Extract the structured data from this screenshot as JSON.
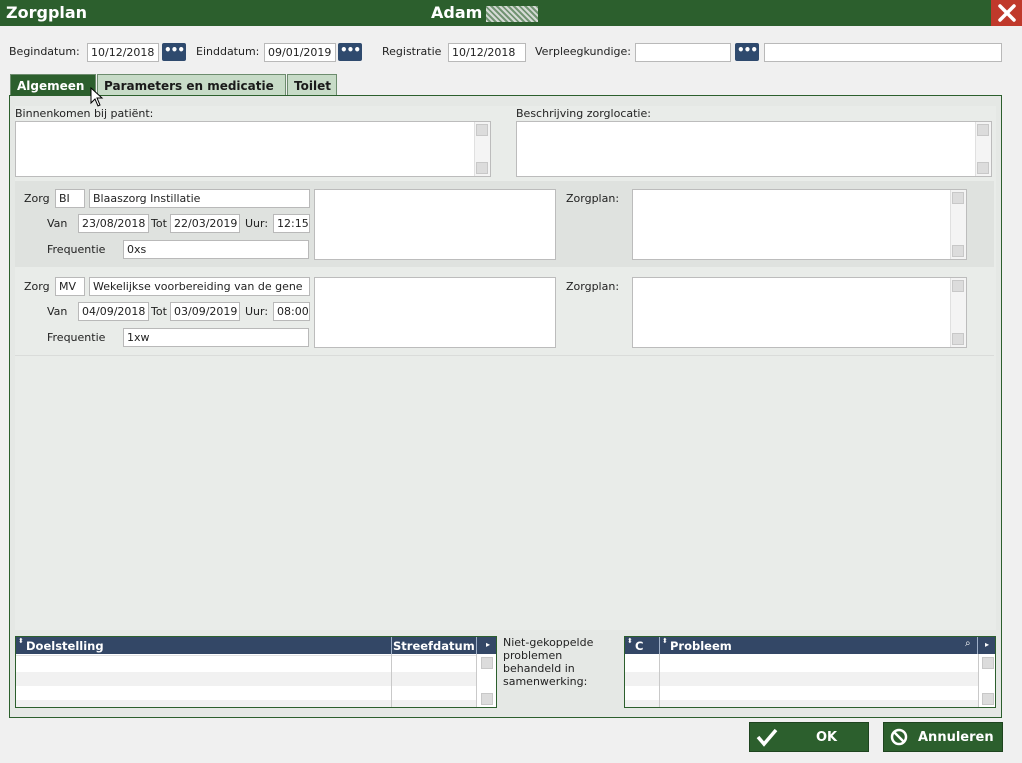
{
  "window": {
    "title": "Zorgplan",
    "patient_name": "Adam"
  },
  "header": {
    "begindatum_label": "Begindatum:",
    "begindatum_value": "10/12/2018",
    "einddatum_label": "Einddatum:",
    "einddatum_value": "09/01/2019",
    "registratie_label": "Registratie",
    "registratie_value": "10/12/2018",
    "verpleegkundige_label": "Verpleegkundige:",
    "verpleegkundige_code": "",
    "verpleegkundige_name": "",
    "picker_glyph": "•••"
  },
  "tabs": [
    {
      "label": "Algemeen",
      "active": true
    },
    {
      "label": "Parameters en medicatie",
      "active": false
    },
    {
      "label": "Toilet",
      "active": false
    }
  ],
  "general": {
    "binnenkomen_label": "Binnenkomen bij patiënt:",
    "beschrijving_label": "Beschrijving zorglocatie:"
  },
  "care_items": [
    {
      "zorg_label": "Zorg",
      "code": "BI",
      "description": "Blaaszorg Instillatie",
      "van_label": "Van",
      "van": "23/08/2018",
      "tot_label": "Tot",
      "tot": "22/03/2019",
      "uur_label": "Uur:",
      "uur": "12:15",
      "frequentie_label": "Frequentie",
      "frequentie": "0xs",
      "zorgplan_label": "Zorgplan:"
    },
    {
      "zorg_label": "Zorg",
      "code": "MV",
      "description": "Wekelijkse voorbereiding van de gene",
      "van_label": "Van",
      "van": "04/09/2018",
      "tot_label": "Tot",
      "tot": "03/09/2019",
      "uur_label": "Uur:",
      "uur": "08:00",
      "frequentie_label": "Frequentie",
      "frequentie": "1xw",
      "zorgplan_label": "Zorgplan:"
    }
  ],
  "goals_grid": {
    "columns": [
      "Doelstelling",
      "Streefdatum"
    ],
    "rows": []
  },
  "problems": {
    "label": "Niet-gekoppelde problemen behandeld in samenwerking:",
    "columns": [
      "C",
      "Probleem"
    ],
    "rows": []
  },
  "buttons": {
    "ok": "OK",
    "cancel": "Annuleren"
  },
  "colors": {
    "primary": "#2c5f2d",
    "grid_header": "#334766",
    "close": "#c0392b"
  }
}
